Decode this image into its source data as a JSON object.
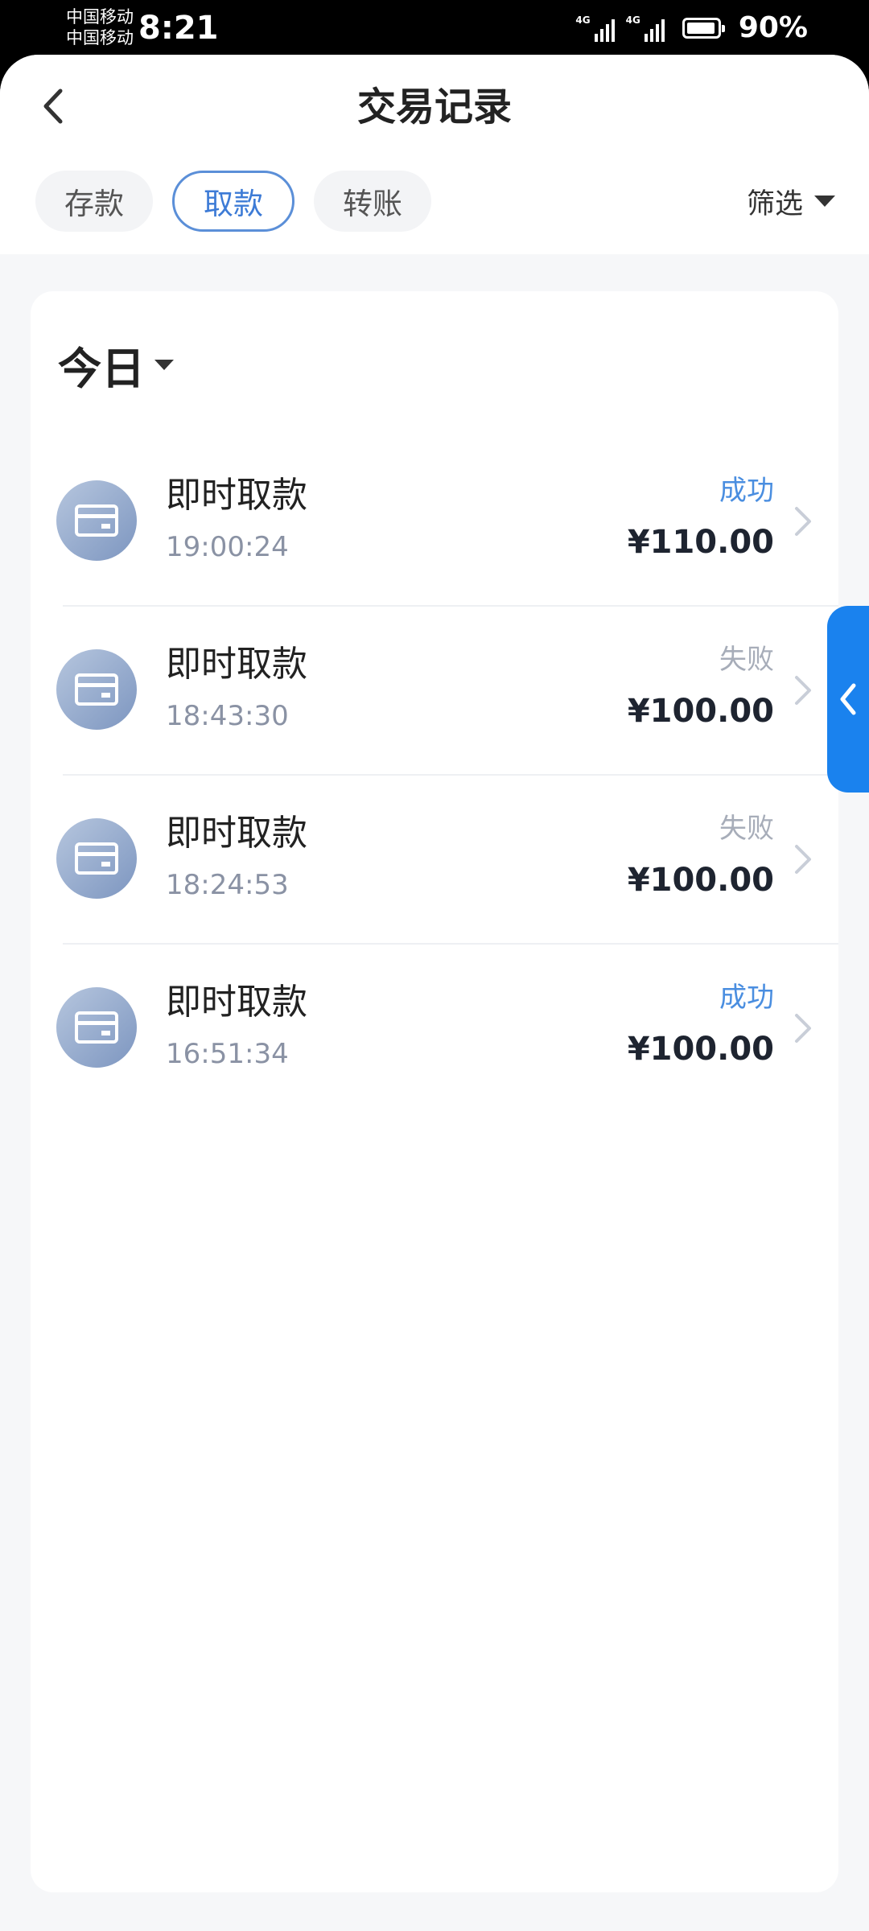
{
  "status_bar": {
    "carrier_1": "中国移动",
    "carrier_2": "中国移动",
    "time": "8:21",
    "network_1": "4G",
    "network_2": "4G",
    "battery": "90%"
  },
  "header": {
    "title": "交易记录",
    "tabs": [
      {
        "label": "存款",
        "active": false
      },
      {
        "label": "取款",
        "active": true
      },
      {
        "label": "转账",
        "active": false
      }
    ],
    "filter_label": "筛选"
  },
  "date_filter": {
    "label": "今日"
  },
  "transactions": [
    {
      "title": "即时取款",
      "time": "19:00:24",
      "status": "成功",
      "amount": "¥110.00"
    },
    {
      "title": "即时取款",
      "time": "18:43:30",
      "status": "失败",
      "amount": "¥100.00"
    },
    {
      "title": "即时取款",
      "time": "18:24:53",
      "status": "失败",
      "amount": "¥100.00"
    },
    {
      "title": "即时取款",
      "time": "16:51:34",
      "status": "成功",
      "amount": "¥100.00"
    }
  ],
  "colors": {
    "accent": "#3d7bd6",
    "success": "#4a8ee0",
    "fail": "#a7adb9",
    "side_tab": "#1a82ee"
  },
  "icons": {
    "back": "chevron-left-icon",
    "transaction": "card-icon",
    "row_action": "chevron-right-icon",
    "side_tab": "chevron-left-icon"
  }
}
